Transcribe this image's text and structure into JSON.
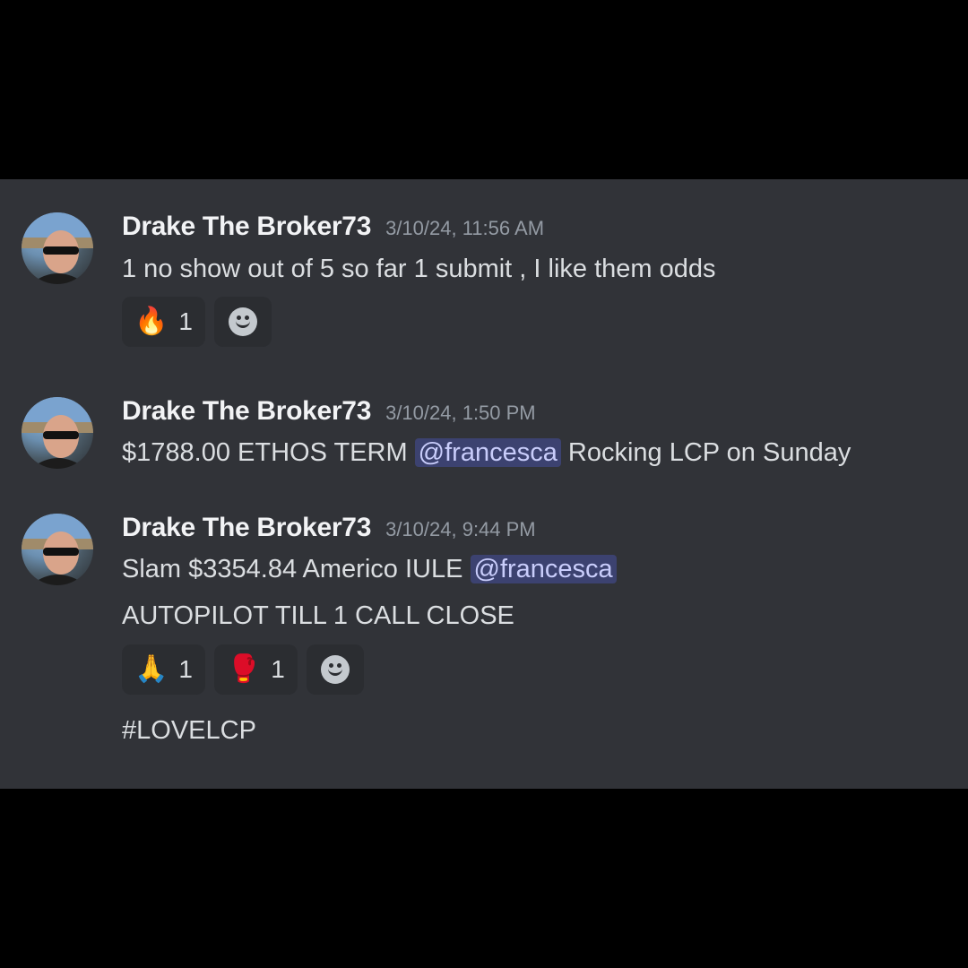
{
  "messages": [
    {
      "username": "Drake The Broker73",
      "timestamp": "3/10/24, 11:56 AM",
      "text": "1 no show out of 5 so far 1 submit , I like them odds",
      "reactions": [
        {
          "emoji": "🔥",
          "icon": "fire-emoji",
          "count": "1"
        }
      ]
    },
    {
      "username": "Drake The Broker73",
      "timestamp": "3/10/24, 1:50 PM",
      "text_before": "$1788.00 ETHOS TERM",
      "mention": "@francesca",
      "text_after": "Rocking LCP on Sunday"
    },
    {
      "username": "Drake The Broker73",
      "timestamp": "3/10/24, 9:44 PM",
      "text_before": "Slam $3354.84 Americo IULE",
      "mention": "@francesca",
      "line2": "AUTOPILOT TILL 1 CALL CLOSE",
      "reactions": [
        {
          "emoji": "🙏",
          "icon": "folded-hands-emoji",
          "count": "1"
        },
        {
          "emoji": "🥊",
          "icon": "boxing-glove-emoji",
          "count": "1"
        }
      ],
      "line3": "#LOVELCP"
    }
  ],
  "colors": {
    "background": "#313338",
    "letterbox": "#000000",
    "mention_bg": "#3c4270",
    "mention_text": "#c9cdfb",
    "username": "#f2f3f5",
    "timestamp": "#949ba4",
    "text": "#dbdee1",
    "reaction_bg": "#2b2d31"
  }
}
